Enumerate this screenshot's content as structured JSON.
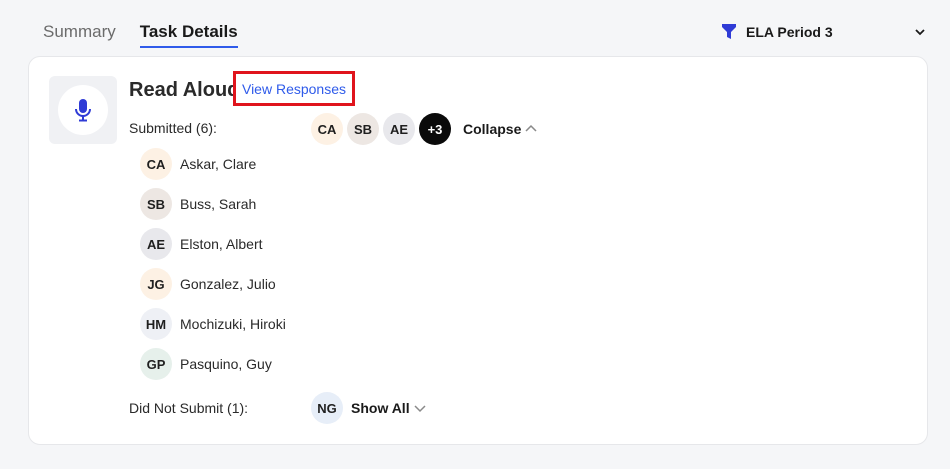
{
  "tabs": [
    {
      "label": "Summary",
      "active": false
    },
    {
      "label": "Task Details",
      "active": true
    }
  ],
  "class_selector": {
    "label": "ELA Period 3",
    "icon": "filter-icon",
    "chevron": "chevron-down-icon",
    "icon_color": "#2f3bd6"
  },
  "task": {
    "icon": "microphone-icon",
    "title": "Read Aloud",
    "view_responses_label": "View Responses"
  },
  "submitted": {
    "label": "Submitted (6):",
    "stack": [
      {
        "initials": "CA",
        "bg": "#fdf1e4"
      },
      {
        "initials": "SB",
        "bg": "#ede7e3"
      },
      {
        "initials": "AE",
        "bg": "#e8e8ec"
      },
      {
        "initials": "+3",
        "bg": "#0a0a0a",
        "fg": "#ffffff"
      }
    ],
    "toggle_label": "Collapse",
    "students": [
      {
        "initials": "CA",
        "name": "Askar, Clare",
        "bg": "#fdf1e4"
      },
      {
        "initials": "SB",
        "name": "Buss, Sarah",
        "bg": "#ede7e3"
      },
      {
        "initials": "AE",
        "name": "Elston, Albert",
        "bg": "#e8e8ec"
      },
      {
        "initials": "JG",
        "name": "Gonzalez, Julio",
        "bg": "#fdf1e4"
      },
      {
        "initials": "HM",
        "name": "Mochizuki, Hiroki",
        "bg": "#eef0f5"
      },
      {
        "initials": "GP",
        "name": "Pasquino, Guy",
        "bg": "#e6f0eb"
      }
    ]
  },
  "not_submitted": {
    "label": "Did Not Submit (1):",
    "stack": [
      {
        "initials": "NG",
        "bg": "#e7eef8"
      }
    ],
    "toggle_label": "Show All"
  },
  "colors": {
    "accent": "#2f5bea",
    "highlight_box": "#e0141c"
  }
}
